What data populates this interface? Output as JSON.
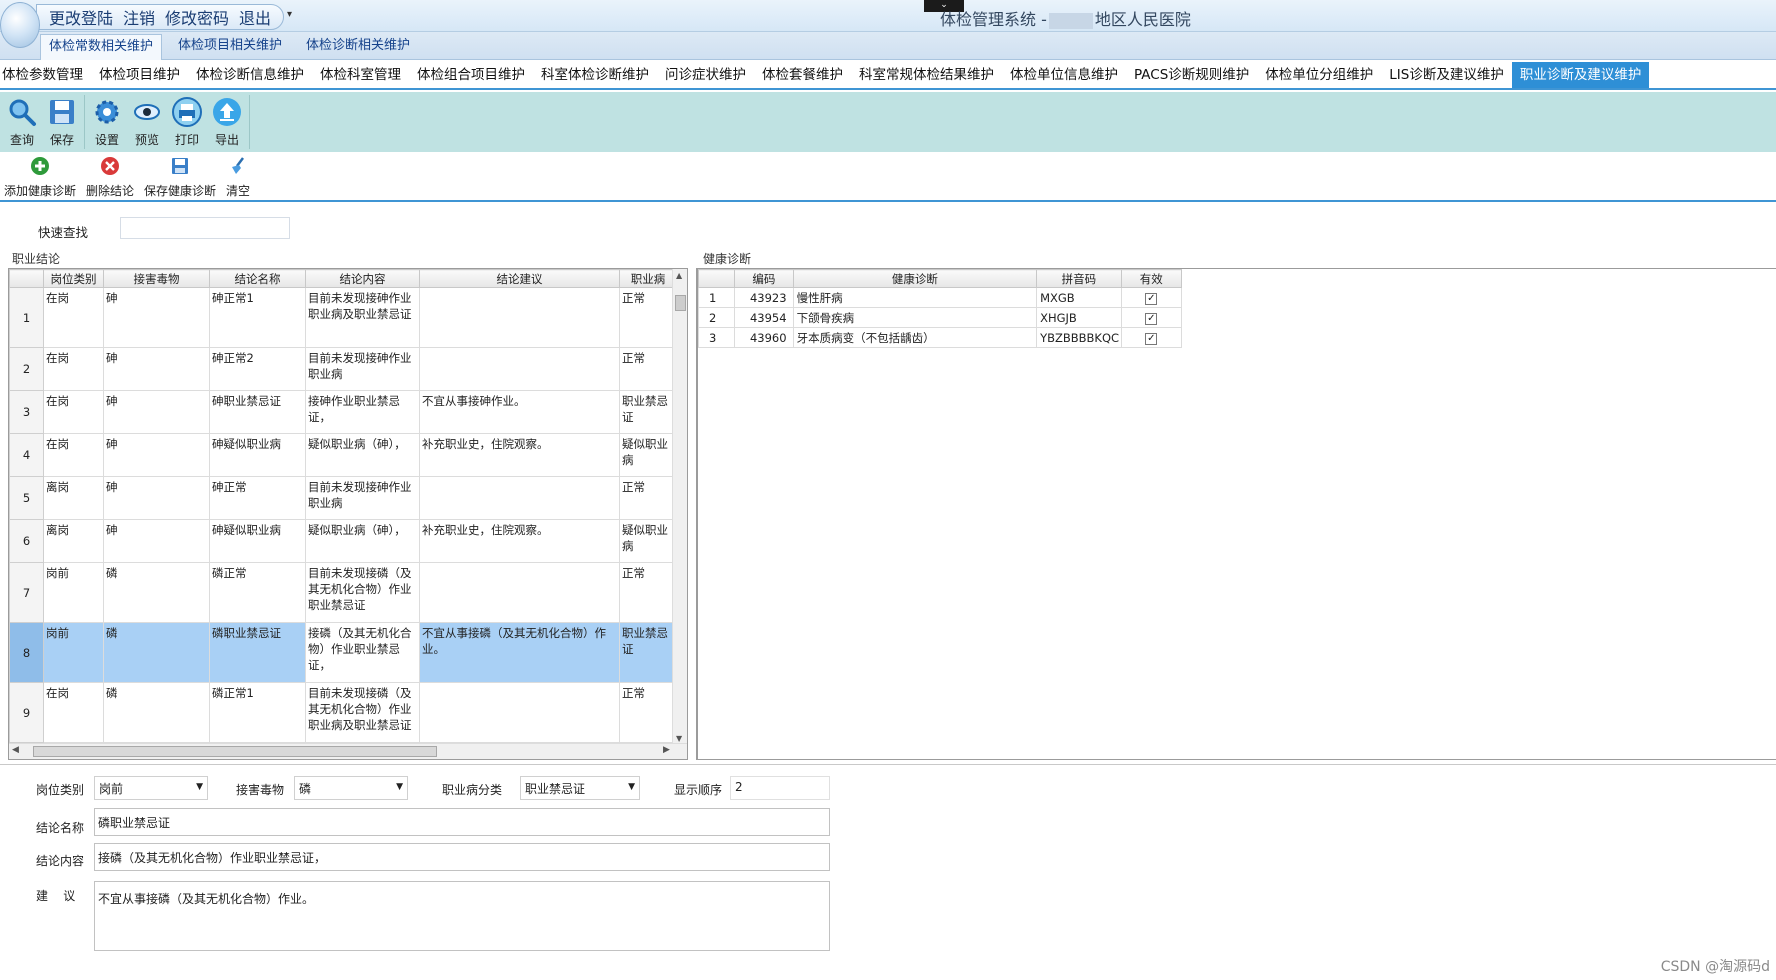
{
  "quick_access": {
    "items": [
      "更改登陆",
      "注销",
      "修改密码",
      "退出"
    ]
  },
  "window": {
    "title_prefix": "体检管理系统  -",
    "title_suffix": "地区人民医院"
  },
  "ribbon_tabs": [
    "体检常数相关维护",
    "体检项目相关维护",
    "体检诊断相关维护"
  ],
  "module_tabs": [
    "体检参数管理",
    "体检项目维护",
    "体检诊断信息维护",
    "体检科室管理",
    "体检组合项目维护",
    "科室体检诊断维护",
    "问诊症状维护",
    "体检套餐维护",
    "科室常规体检结果维护",
    "体检单位信息维护",
    "PACS诊断规则维护",
    "体检单位分组维护",
    "LIS诊断及建议维护",
    "职业诊断及建议维护"
  ],
  "toolbar": {
    "buttons": [
      {
        "label": "查询",
        "icon": "search-icon"
      },
      {
        "label": "保存",
        "icon": "save-icon"
      },
      {
        "label": "设置",
        "icon": "gear-icon"
      },
      {
        "label": "预览",
        "icon": "eye-icon"
      },
      {
        "label": "打印",
        "icon": "print-icon"
      },
      {
        "label": "导出",
        "icon": "export-icon"
      }
    ]
  },
  "subbar": {
    "buttons": [
      {
        "label": "添加健康诊断",
        "icon": "add-icon"
      },
      {
        "label": "删除结论",
        "icon": "delete-icon"
      },
      {
        "label": "保存健康诊断",
        "icon": "save-icon"
      },
      {
        "label": "清空",
        "icon": "broom-icon"
      }
    ]
  },
  "quick_search": {
    "label": "快速查找",
    "value": ""
  },
  "conclusion_panel": {
    "title": "职业结论",
    "columns": [
      "岗位类别",
      "接害毒物",
      "结论名称",
      "结论内容",
      "结论建议",
      "职业病"
    ],
    "rows": [
      {
        "n": "1",
        "post": "在岗",
        "toxin": "砷",
        "name": "砷正常1",
        "content": "目前未发现接砷作业职业病及职业禁忌证",
        "advice": "",
        "cls": "正常"
      },
      {
        "n": "2",
        "post": "在岗",
        "toxin": "砷",
        "name": "砷正常2",
        "content": "目前未发现接砷作业职业病",
        "advice": "",
        "cls": "正常"
      },
      {
        "n": "3",
        "post": "在岗",
        "toxin": "砷",
        "name": "砷职业禁忌证",
        "content": "接砷作业职业禁忌证，",
        "advice": "不宜从事接砷作业。",
        "cls": "职业禁忌证"
      },
      {
        "n": "4",
        "post": "在岗",
        "toxin": "砷",
        "name": "砷疑似职业病",
        "content": "疑似职业病（砷），",
        "advice": "补充职业史，住院观察。",
        "cls": "疑似职业病"
      },
      {
        "n": "5",
        "post": "离岗",
        "toxin": "砷",
        "name": "砷正常",
        "content": "目前未发现接砷作业职业病",
        "advice": "",
        "cls": "正常"
      },
      {
        "n": "6",
        "post": "离岗",
        "toxin": "砷",
        "name": "砷疑似职业病",
        "content": "疑似职业病（砷），",
        "advice": "补充职业史，住院观察。",
        "cls": "疑似职业病"
      },
      {
        "n": "7",
        "post": "岗前",
        "toxin": "磷",
        "name": "磷正常",
        "content": "目前未发现接磷（及其无机化合物）作业职业禁忌证",
        "advice": "",
        "cls": "正常"
      },
      {
        "n": "8",
        "post": "岗前",
        "toxin": "磷",
        "name": "磷职业禁忌证",
        "content": "接磷（及其无机化合物）作业职业禁忌证，",
        "advice": "不宜从事接磷（及其无机化合物）作业。",
        "cls": "职业禁忌证"
      },
      {
        "n": "9",
        "post": "在岗",
        "toxin": "磷",
        "name": "磷正常1",
        "content": "目前未发现接磷（及其无机化合物）作业职业病及职业禁忌证",
        "advice": "",
        "cls": "正常"
      }
    ]
  },
  "diagnosis_panel": {
    "title": "健康诊断",
    "columns": [
      "编码",
      "健康诊断",
      "拼音码",
      "有效"
    ],
    "rows": [
      {
        "n": "1",
        "code": "43923",
        "name": "慢性肝病",
        "py": "MXGB",
        "valid": "✓"
      },
      {
        "n": "2",
        "code": "43954",
        "name": "下颌骨疾病",
        "py": "XHGJB",
        "valid": "✓"
      },
      {
        "n": "3",
        "code": "43960",
        "name": "牙本质病变（不包括龋齿）",
        "py": "YBZBBBBKQC",
        "valid": "✓"
      }
    ]
  },
  "form": {
    "post_label": "岗位类别",
    "post_value": "岗前",
    "toxin_label": "接害毒物",
    "toxin_value": "磷",
    "cls_label": "职业病分类",
    "cls_value": "职业禁忌证",
    "order_label": "显示顺序",
    "order_value": "2",
    "name_label": "结论名称",
    "name_value": "磷职业禁忌证",
    "content_label": "结论内容",
    "content_value": "接磷（及其无机化合物）作业职业禁忌证，",
    "advice_label": "建    议",
    "advice_value": "不宜从事接磷（及其无机化合物）作业。"
  },
  "watermark": "CSDN @淘源码d"
}
